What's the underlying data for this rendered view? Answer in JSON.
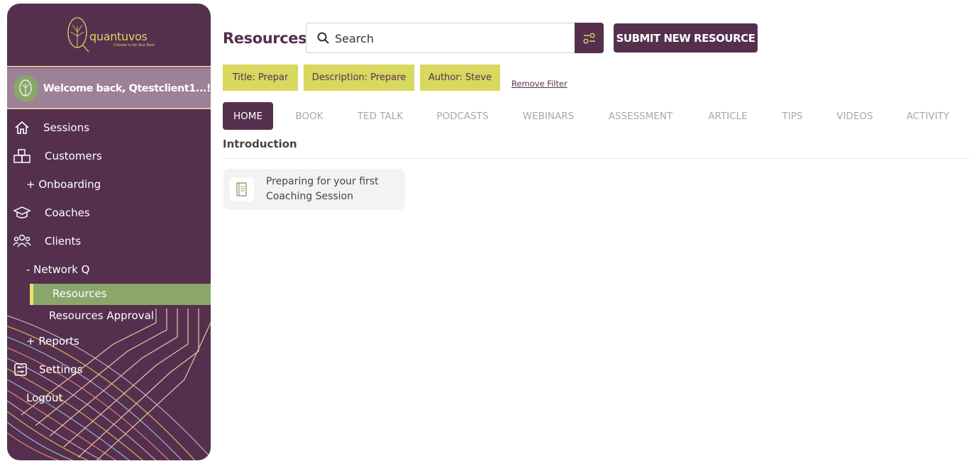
{
  "brand": {
    "name": "quantuvos",
    "tagline": "Choose to be Your Best"
  },
  "welcome": {
    "text": "Welcome back, Qtestclient1...!"
  },
  "sidebar": {
    "items": [
      {
        "label": "Sessions",
        "icon": "home-icon"
      },
      {
        "label": "Customers",
        "icon": "boxes-icon"
      },
      {
        "label": "+ Onboarding"
      },
      {
        "label": "Coaches",
        "icon": "graduation-cap-icon"
      },
      {
        "label": "Clients",
        "icon": "users-icon"
      },
      {
        "label": "- Network Q"
      },
      {
        "label": "Resources",
        "active": true
      },
      {
        "label": "Resources Approval"
      },
      {
        "label": "+ Reports"
      },
      {
        "label": "Settings",
        "icon": "settings-sliders-icon"
      },
      {
        "label": "Logout"
      }
    ]
  },
  "header": {
    "title": "Resources",
    "search_placeholder": "Search",
    "submit_label": "SUBMIT NEW RESOURCE"
  },
  "filters": {
    "chips": [
      "Title: Prepar",
      "Description: Prepare",
      "Author: Steve"
    ],
    "remove_label": "Remove Filter"
  },
  "tabs": [
    "HOME",
    "BOOK",
    "TED TALK",
    "PODCASTS",
    "WEBINARS",
    "ASSESSMENT",
    "ARTICLE",
    "TIPS",
    "VIDEOS",
    "ACTIVITY"
  ],
  "active_tab": "HOME",
  "section": {
    "title": "Introduction"
  },
  "cards": [
    {
      "title": "Preparing for your first Coaching Session",
      "icon": "book-icon"
    }
  ],
  "colors": {
    "primary": "#55304e",
    "accent": "#d8d75e",
    "active_green": "#8aa66b"
  }
}
